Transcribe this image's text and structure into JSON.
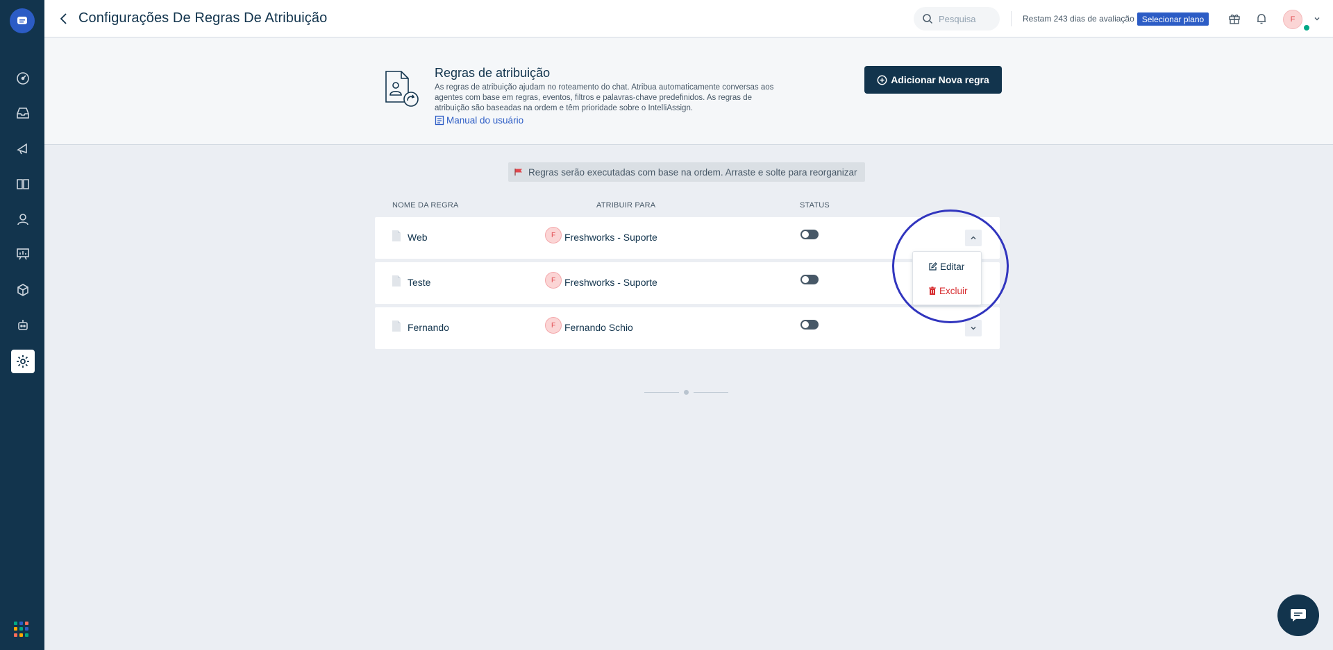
{
  "app": {
    "page_title": "Configurações De Regras De Atribuição"
  },
  "topbar": {
    "search_placeholder": "Pesquisa",
    "trial_text": "Restam 243 dias de avaliação",
    "plan_button": "Selecionar plano",
    "user_initial": "F"
  },
  "header": {
    "title": "Regras de atribuição",
    "description": "As regras de atribuição ajudam no roteamento do chat. Atribua automaticamente conversas aos agentes com base em regras, eventos, filtros e palavras-chave predefinidos. As regras de atribuição são baseadas na ordem e têm prioridade sobre o IntelliAssign.",
    "manual_link": "Manual do usuário",
    "add_button": "Adicionar Nova regra"
  },
  "info_banner": "Regras serão executadas com base na ordem. Arraste e solte para reorganizar",
  "table": {
    "columns": [
      "NOME DA REGRA",
      "ATRIBUIR PARA",
      "STATUS"
    ],
    "rows": [
      {
        "name": "Web",
        "assign_to": "Freshworks - Suporte",
        "initial": "F",
        "enabled": false,
        "expanded": true
      },
      {
        "name": "Teste",
        "assign_to": "Freshworks - Suporte",
        "initial": "F",
        "enabled": false,
        "expanded": false
      },
      {
        "name": "Fernando",
        "assign_to": "Fernando Schio",
        "initial": "F",
        "enabled": false,
        "expanded": false
      }
    ]
  },
  "dropdown": {
    "edit": "Editar",
    "delete": "Excluir"
  },
  "colors": {
    "sidebar": "#12344d",
    "primary": "#12344d",
    "accent": "#2c5cc5",
    "danger": "#d72d30",
    "annotation_circle": "#3135be"
  },
  "icons": {
    "sidebar": [
      "dashboard-icon",
      "inbox-icon",
      "campaigns-icon",
      "knowledge-base-icon",
      "contacts-icon",
      "reports-icon",
      "integrations-icon",
      "bots-icon",
      "settings-icon"
    ]
  }
}
